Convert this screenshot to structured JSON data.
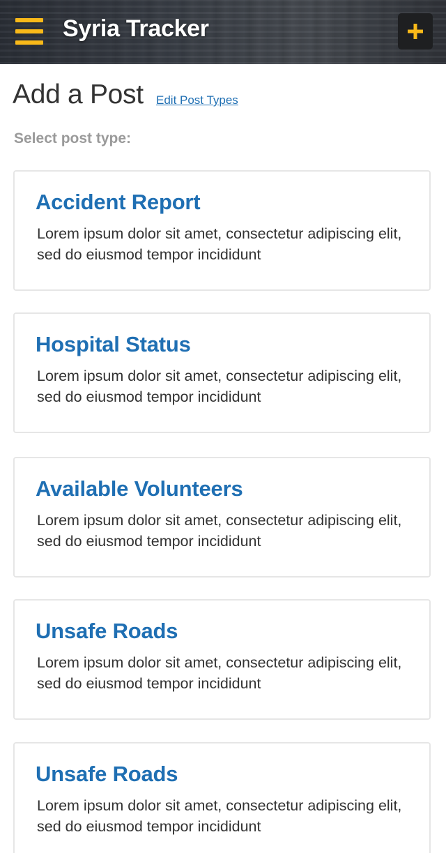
{
  "header": {
    "menu_icon": "hamburger-menu-icon",
    "title": "Syria Tracker",
    "add_icon": "plus-icon",
    "accent_color": "#f9b919"
  },
  "main": {
    "page_title": "Add a Post",
    "edit_link": "Edit Post Types",
    "select_label": "Select post type:",
    "link_color": "#1f6fb3"
  },
  "post_types": [
    {
      "title": "Accident Report",
      "description": "Lorem ipsum dolor sit amet, consectetur adipiscing elit, sed do eiusmod tempor incididunt"
    },
    {
      "title": "Hospital Status",
      "description": "Lorem ipsum dolor sit amet, consectetur adipiscing elit, sed do eiusmod tempor incididunt"
    },
    {
      "title": "Available Volunteers",
      "description": "Lorem ipsum dolor sit amet, consectetur adipiscing elit, sed do eiusmod tempor incididunt"
    },
    {
      "title": "Unsafe Roads",
      "description": "Lorem ipsum dolor sit amet, consectetur adipiscing elit, sed do eiusmod tempor incididunt"
    },
    {
      "title": "Unsafe Roads",
      "description": "Lorem ipsum dolor sit amet, consectetur adipiscing elit, sed do eiusmod tempor incididunt"
    }
  ]
}
